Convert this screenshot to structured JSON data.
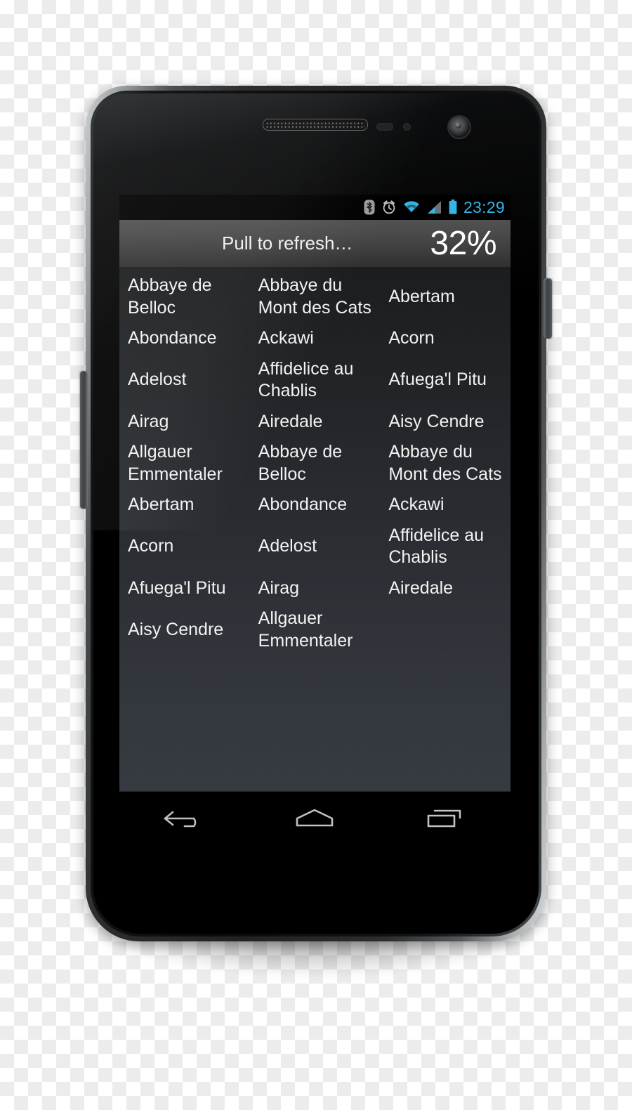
{
  "statusbar": {
    "icons": [
      "bluetooth-icon",
      "alarm-clock-icon",
      "wifi-icon",
      "cellular-signal-icon",
      "battery-icon"
    ],
    "clock": "23:29",
    "clock_color": "#33b5e5"
  },
  "refresh_header": {
    "label": "Pull to refresh…",
    "percent": "32%"
  },
  "grid": {
    "columns": 3,
    "items": [
      "Abbaye de Belloc",
      "Abbaye du Mont des Cats",
      "Abertam",
      "Abondance",
      "Ackawi",
      "Acorn",
      "Adelost",
      "Affidelice au Chablis",
      "Afuega'l Pitu",
      "Airag",
      "Airedale",
      "Aisy Cendre",
      "Allgauer Emmentaler",
      "Abbaye de Belloc",
      "Abbaye du Mont des Cats",
      "Abertam",
      "Abondance",
      "Ackawi",
      "Acorn",
      "Adelost",
      "Affidelice au Chablis",
      "Afuega'l Pitu",
      "Airag",
      "Airedale",
      "Aisy Cendre",
      "Allgauer Emmentaler"
    ]
  },
  "navbar": {
    "buttons": [
      {
        "name": "back-icon",
        "label": "Back"
      },
      {
        "name": "home-icon",
        "label": "Home"
      },
      {
        "name": "recents-icon",
        "label": "Recents"
      }
    ]
  },
  "device": {
    "hardware": [
      "earpiece-speaker",
      "proximity-sensor",
      "light-sensor",
      "front-camera",
      "power-button",
      "volume-rocker"
    ]
  }
}
